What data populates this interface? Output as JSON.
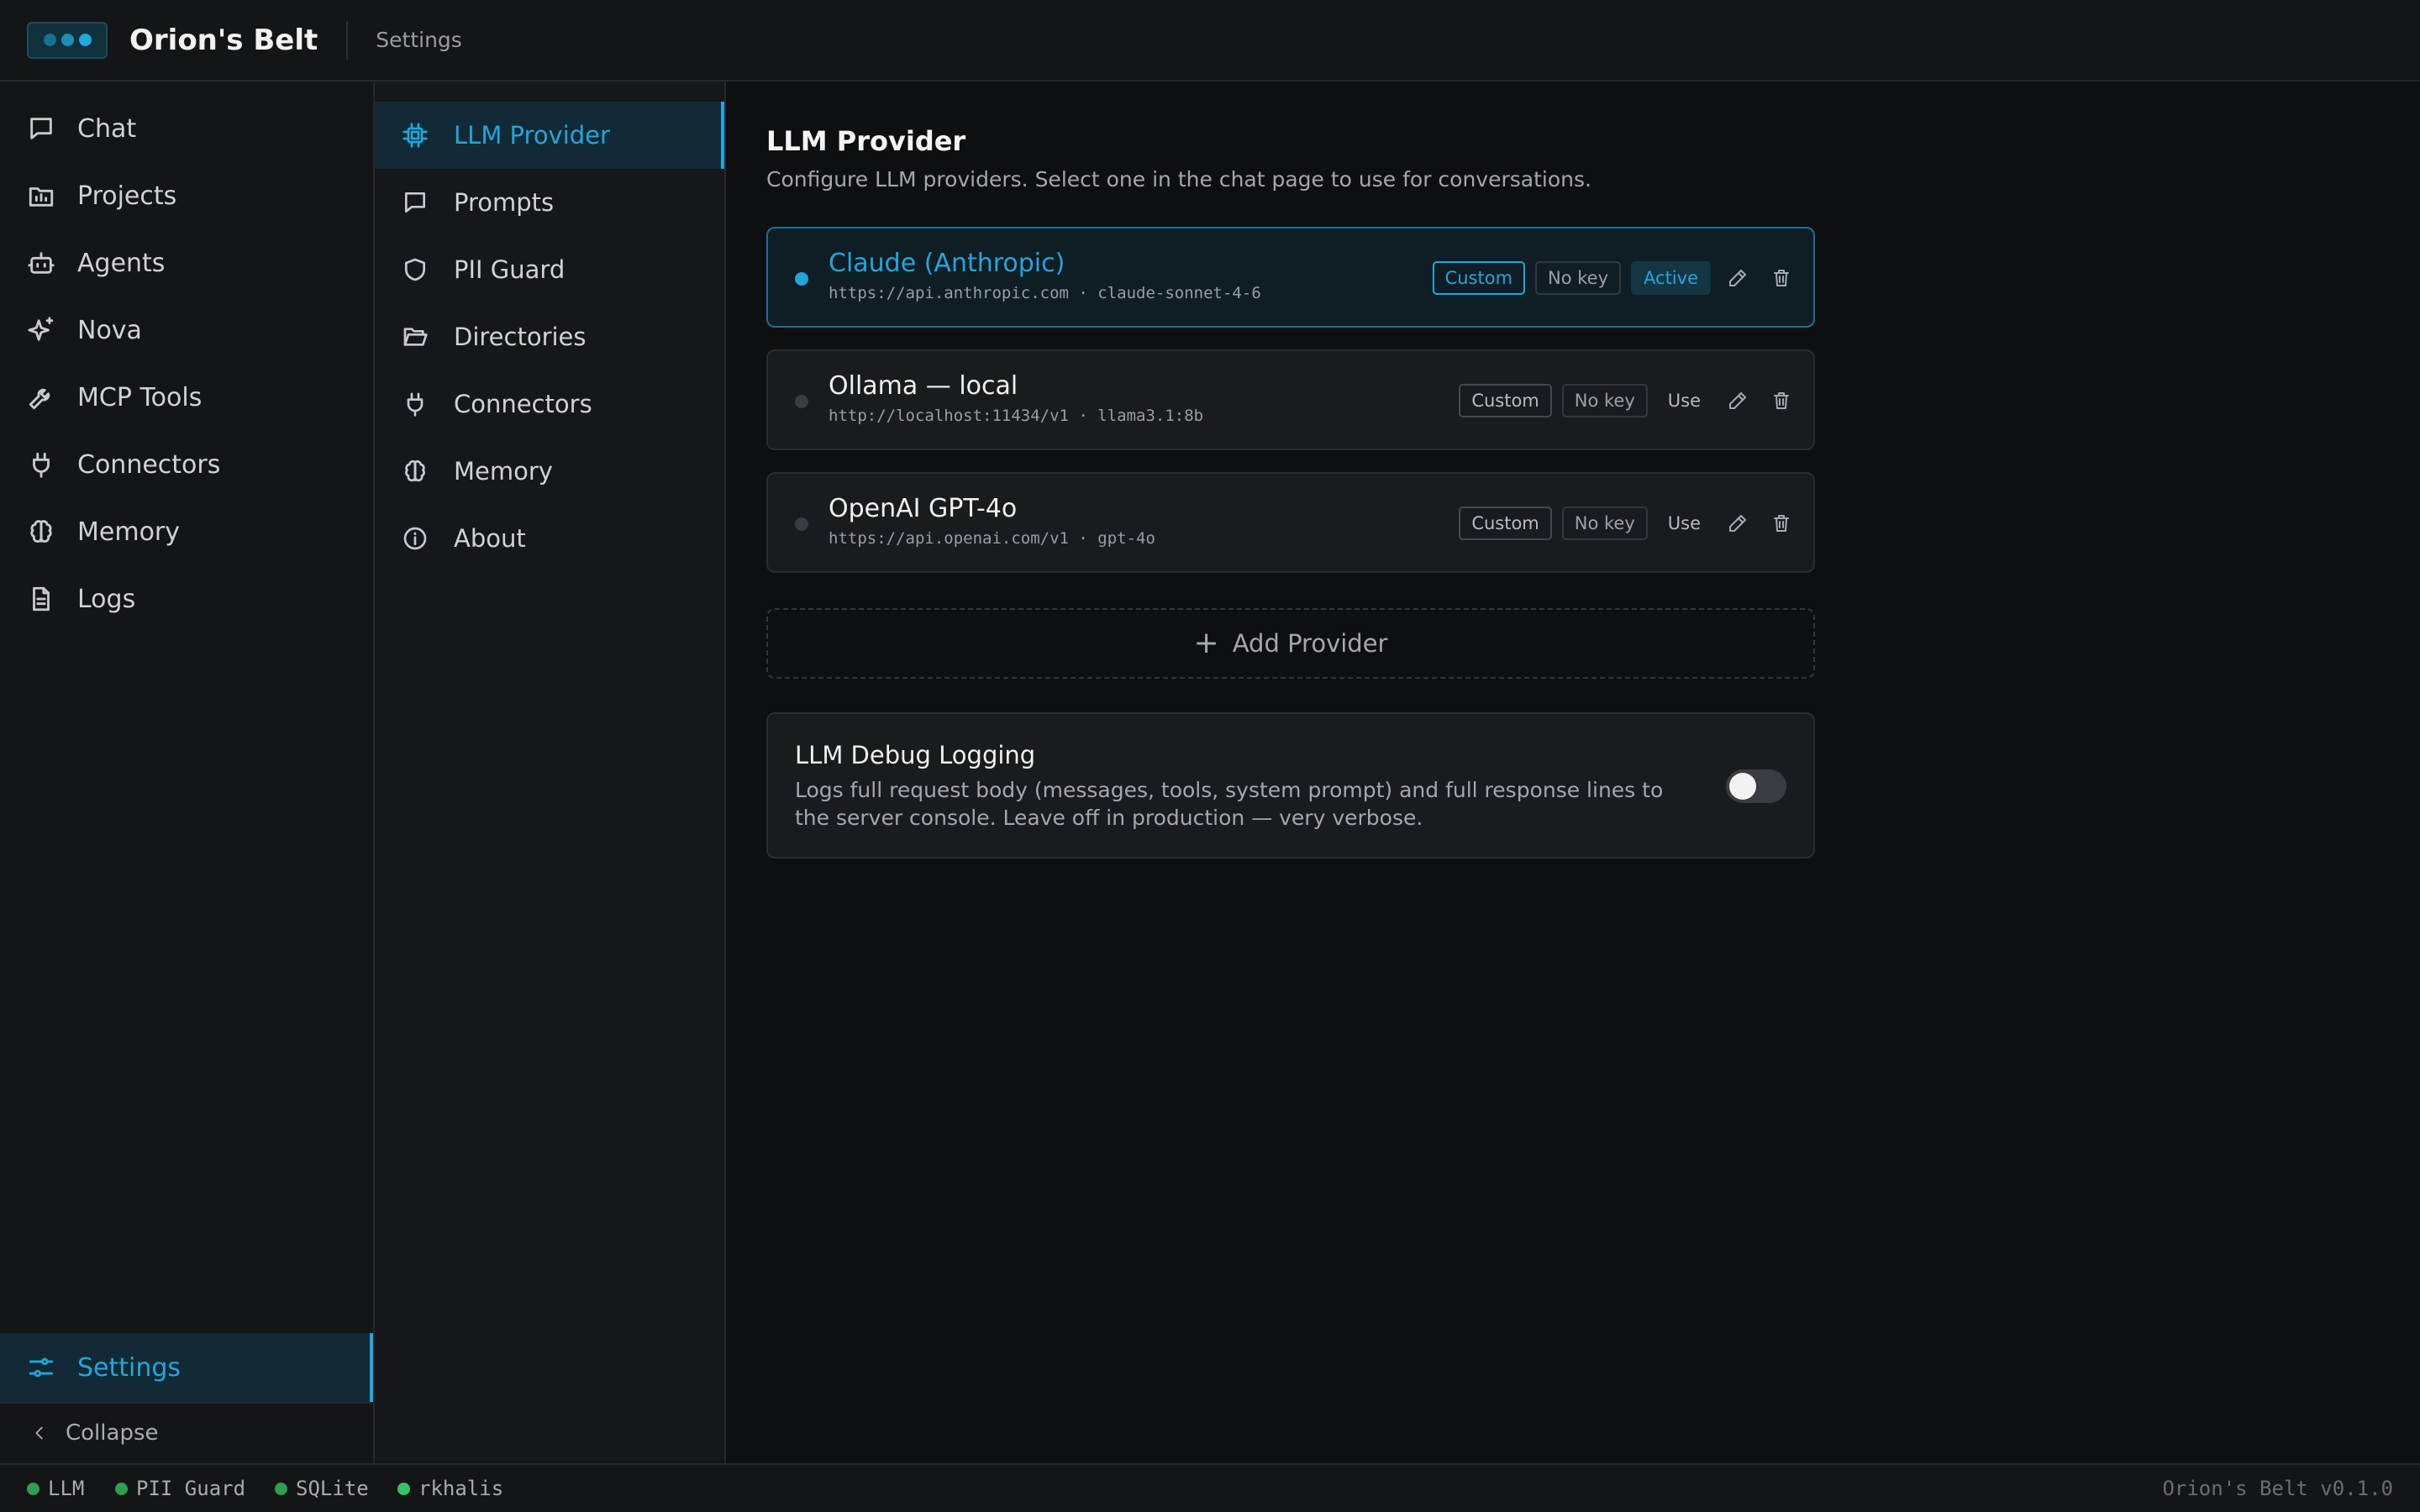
{
  "header": {
    "app_title": "Orion's Belt",
    "breadcrumb": "Settings",
    "logo_dot_colors": [
      "#1a6f8e",
      "#1d8eb7",
      "#22a6dc"
    ]
  },
  "sidebar": {
    "items": [
      {
        "label": "Chat",
        "icon": "chat-icon"
      },
      {
        "label": "Projects",
        "icon": "projects-icon"
      },
      {
        "label": "Agents",
        "icon": "bot-icon"
      },
      {
        "label": "Nova",
        "icon": "sparkles-icon"
      },
      {
        "label": "MCP Tools",
        "icon": "wrench-icon"
      },
      {
        "label": "Connectors",
        "icon": "plug-icon"
      },
      {
        "label": "Memory",
        "icon": "brain-icon"
      },
      {
        "label": "Logs",
        "icon": "document-icon"
      }
    ],
    "settings_label": "Settings",
    "collapse_label": "Collapse"
  },
  "settings_nav": {
    "items": [
      {
        "label": "LLM Provider",
        "icon": "chip-icon",
        "active": true
      },
      {
        "label": "Prompts",
        "icon": "chat-icon"
      },
      {
        "label": "PII Guard",
        "icon": "shield-icon"
      },
      {
        "label": "Directories",
        "icon": "folder-open-icon"
      },
      {
        "label": "Connectors",
        "icon": "plug-icon"
      },
      {
        "label": "Memory",
        "icon": "brain-icon"
      },
      {
        "label": "About",
        "icon": "info-icon"
      }
    ]
  },
  "main": {
    "title": "LLM Provider",
    "description": "Configure LLM providers. Select one in the chat page to use for conversations.",
    "providers": [
      {
        "name": "Claude (Anthropic)",
        "url": "https://api.anthropic.com · claude-sonnet-4-6",
        "tag": "Custom",
        "key_status": "No key",
        "state": "Active"
      },
      {
        "name": "Ollama — local",
        "url": "http://localhost:11434/v1 · llama3.1:8b",
        "tag": "Custom",
        "key_status": "No key",
        "state": "Use"
      },
      {
        "name": "OpenAI GPT-4o",
        "url": "https://api.openai.com/v1 · gpt-4o",
        "tag": "Custom",
        "key_status": "No key",
        "state": "Use"
      }
    ],
    "add_provider_label": "Add Provider",
    "debug": {
      "title": "LLM Debug Logging",
      "description": "Logs full request body (messages, tools, system prompt) and full response lines to the server console. Leave off in production — very verbose.",
      "enabled": false
    }
  },
  "statusbar": {
    "items": [
      {
        "label": "LLM",
        "color": "#2f9e52"
      },
      {
        "label": "PII Guard",
        "color": "#2f9e52"
      },
      {
        "label": "SQLite",
        "color": "#2f9e52"
      },
      {
        "label": "rkhalis",
        "color": "#35c26a"
      }
    ],
    "version": "Orion's Belt v0.1.0"
  },
  "colors": {
    "accent": "#22a6dc",
    "background": "#0e0f11",
    "panel": "#141517"
  }
}
